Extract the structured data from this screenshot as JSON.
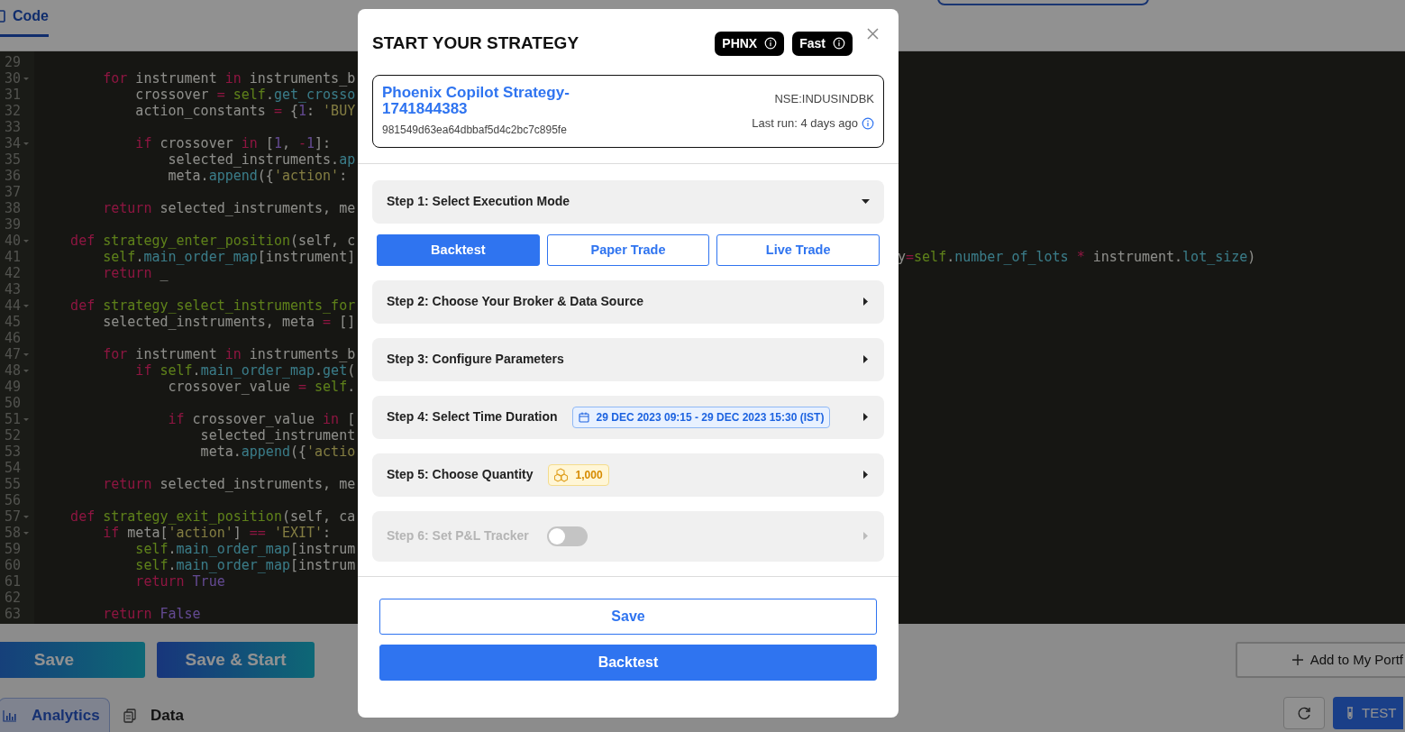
{
  "code_tab": {
    "label": "Code",
    "selected": true
  },
  "editor": {
    "lines": [
      {
        "num": "29",
        "foldable": false
      },
      {
        "num": "30",
        "foldable": true,
        "parts": [
          {
            "kind": "keyword",
            "text": "        for"
          },
          {
            "kind": "plain",
            "text": " instrument "
          },
          {
            "kind": "keyword",
            "text": "in"
          },
          {
            "kind": "plain",
            "text": " instruments_b"
          }
        ]
      },
      {
        "num": "31",
        "foldable": false,
        "parts": [
          {
            "kind": "plain",
            "text": "            crossover "
          },
          {
            "kind": "operator",
            "text": "= "
          },
          {
            "kind": "name",
            "text": "self"
          },
          {
            "kind": "plain",
            "text": "."
          },
          {
            "kind": "attr",
            "text": "get_crosso"
          }
        ]
      },
      {
        "num": "32",
        "foldable": false,
        "parts": [
          {
            "kind": "plain",
            "text": "            action_constants "
          },
          {
            "kind": "operator",
            "text": "="
          },
          {
            "kind": "plain",
            "text": " {"
          },
          {
            "kind": "number",
            "text": "1"
          },
          {
            "kind": "plain",
            "text": ": "
          },
          {
            "kind": "string",
            "text": "'BUY"
          }
        ]
      },
      {
        "num": "33",
        "foldable": false
      },
      {
        "num": "34",
        "foldable": true,
        "parts": [
          {
            "kind": "keyword",
            "text": "            if"
          },
          {
            "kind": "plain",
            "text": " crossover "
          },
          {
            "kind": "keyword",
            "text": "in"
          },
          {
            "kind": "plain",
            "text": " ["
          },
          {
            "kind": "number",
            "text": "1"
          },
          {
            "kind": "plain",
            "text": ", "
          },
          {
            "kind": "operator",
            "text": "-"
          },
          {
            "kind": "number",
            "text": "1"
          },
          {
            "kind": "plain",
            "text": "]:"
          }
        ]
      },
      {
        "num": "35",
        "foldable": false,
        "parts": [
          {
            "kind": "plain",
            "text": "                selected_instruments."
          },
          {
            "kind": "attr",
            "text": "ap"
          }
        ]
      },
      {
        "num": "36",
        "foldable": false,
        "parts": [
          {
            "kind": "plain",
            "text": "                meta."
          },
          {
            "kind": "attr",
            "text": "append"
          },
          {
            "kind": "plain",
            "text": "({"
          },
          {
            "kind": "string",
            "text": "'action'"
          },
          {
            "kind": "plain",
            "text": ":"
          }
        ]
      },
      {
        "num": "37",
        "foldable": false
      },
      {
        "num": "38",
        "foldable": false,
        "parts": [
          {
            "kind": "keyword",
            "text": "        return"
          },
          {
            "kind": "plain",
            "text": " selected_instruments, me"
          }
        ]
      },
      {
        "num": "39",
        "foldable": false
      },
      {
        "num": "40",
        "foldable": true,
        "parts": [
          {
            "kind": "keyword",
            "text": "    def"
          },
          {
            "kind": "name",
            "text": " strategy_enter_position"
          },
          {
            "kind": "plain",
            "text": "(self, c"
          }
        ]
      },
      {
        "num": "41",
        "foldable": false,
        "parts": [
          {
            "kind": "name",
            "text": "        self"
          },
          {
            "kind": "plain",
            "text": "."
          },
          {
            "kind": "attr",
            "text": "main_order_map"
          },
          {
            "kind": "plain",
            "text": "[instrument]"
          }
        ],
        "tail": [
          {
            "kind": "plain",
            "text": "y"
          },
          {
            "kind": "operator",
            "text": "="
          },
          {
            "kind": "name",
            "text": "self"
          },
          {
            "kind": "plain",
            "text": "."
          },
          {
            "kind": "attr",
            "text": "number_of_lots"
          },
          {
            "kind": "operator",
            "text": " * "
          },
          {
            "kind": "plain",
            "text": "instrument."
          },
          {
            "kind": "attr",
            "text": "lot_size"
          },
          {
            "kind": "plain",
            "text": ")"
          }
        ]
      },
      {
        "num": "42",
        "foldable": false,
        "parts": [
          {
            "kind": "keyword",
            "text": "        return"
          },
          {
            "kind": "plain",
            "text": " _"
          }
        ]
      },
      {
        "num": "43",
        "foldable": false
      },
      {
        "num": "44",
        "foldable": true,
        "parts": [
          {
            "kind": "keyword",
            "text": "    def"
          },
          {
            "kind": "name",
            "text": " strategy_select_instruments_for"
          }
        ]
      },
      {
        "num": "45",
        "foldable": false,
        "parts": [
          {
            "kind": "plain",
            "text": "        selected_instruments, meta "
          },
          {
            "kind": "operator",
            "text": "="
          },
          {
            "kind": "plain",
            "text": " []"
          }
        ]
      },
      {
        "num": "46",
        "foldable": false
      },
      {
        "num": "47",
        "foldable": true,
        "parts": [
          {
            "kind": "keyword",
            "text": "        for"
          },
          {
            "kind": "plain",
            "text": " instrument "
          },
          {
            "kind": "keyword",
            "text": "in"
          },
          {
            "kind": "plain",
            "text": " instruments_b"
          }
        ]
      },
      {
        "num": "48",
        "foldable": true,
        "parts": [
          {
            "kind": "keyword",
            "text": "            if"
          },
          {
            "kind": "name",
            "text": " self"
          },
          {
            "kind": "plain",
            "text": "."
          },
          {
            "kind": "attr",
            "text": "main_order_map"
          },
          {
            "kind": "plain",
            "text": "."
          },
          {
            "kind": "attr",
            "text": "get"
          },
          {
            "kind": "plain",
            "text": "("
          }
        ]
      },
      {
        "num": "49",
        "foldable": false,
        "parts": [
          {
            "kind": "plain",
            "text": "                crossover_value "
          },
          {
            "kind": "operator",
            "text": "= "
          },
          {
            "kind": "name",
            "text": "self"
          },
          {
            "kind": "plain",
            "text": "."
          }
        ]
      },
      {
        "num": "50",
        "foldable": false
      },
      {
        "num": "51",
        "foldable": true,
        "parts": [
          {
            "kind": "keyword",
            "text": "                if"
          },
          {
            "kind": "plain",
            "text": " crossover_value "
          },
          {
            "kind": "keyword",
            "text": "in"
          },
          {
            "kind": "plain",
            "text": " ["
          }
        ]
      },
      {
        "num": "52",
        "foldable": false,
        "parts": [
          {
            "kind": "plain",
            "text": "                    selected_instrument"
          }
        ]
      },
      {
        "num": "53",
        "foldable": false,
        "parts": [
          {
            "kind": "plain",
            "text": "                    meta."
          },
          {
            "kind": "attr",
            "text": "append"
          },
          {
            "kind": "plain",
            "text": "({"
          },
          {
            "kind": "string",
            "text": "'actio"
          }
        ]
      },
      {
        "num": "54",
        "foldable": false
      },
      {
        "num": "55",
        "foldable": false,
        "parts": [
          {
            "kind": "keyword",
            "text": "        return"
          },
          {
            "kind": "plain",
            "text": " selected_instruments, me"
          }
        ]
      },
      {
        "num": "56",
        "foldable": false
      },
      {
        "num": "57",
        "foldable": true,
        "parts": [
          {
            "kind": "keyword",
            "text": "    def"
          },
          {
            "kind": "name",
            "text": " strategy_exit_position"
          },
          {
            "kind": "plain",
            "text": "(self, ca"
          }
        ]
      },
      {
        "num": "58",
        "foldable": true,
        "parts": [
          {
            "kind": "keyword",
            "text": "        if"
          },
          {
            "kind": "plain",
            "text": " meta["
          },
          {
            "kind": "string",
            "text": "'action'"
          },
          {
            "kind": "plain",
            "text": "] "
          },
          {
            "kind": "operator",
            "text": "== "
          },
          {
            "kind": "string",
            "text": "'EXIT'"
          },
          {
            "kind": "plain",
            "text": ":"
          }
        ]
      },
      {
        "num": "59",
        "foldable": false,
        "parts": [
          {
            "kind": "name",
            "text": "            self"
          },
          {
            "kind": "plain",
            "text": "."
          },
          {
            "kind": "attr",
            "text": "main_order_map"
          },
          {
            "kind": "plain",
            "text": "[instrum"
          }
        ]
      },
      {
        "num": "60",
        "foldable": false,
        "parts": [
          {
            "kind": "name",
            "text": "            self"
          },
          {
            "kind": "plain",
            "text": "."
          },
          {
            "kind": "attr",
            "text": "main_order_map"
          },
          {
            "kind": "plain",
            "text": "[instrum"
          }
        ]
      },
      {
        "num": "61",
        "foldable": false,
        "parts": [
          {
            "kind": "keyword",
            "text": "            return"
          },
          {
            "kind": "number",
            "text": " True"
          }
        ]
      },
      {
        "num": "62",
        "foldable": false
      },
      {
        "num": "63",
        "foldable": false,
        "parts": [
          {
            "kind": "keyword",
            "text": "        return"
          },
          {
            "kind": "number",
            "text": " False"
          }
        ]
      }
    ]
  },
  "actions": {
    "save": "Save",
    "save_start": "Save & Start",
    "add_portfolio": "Add to My Portf"
  },
  "bottom_tabs": [
    {
      "label": "Analytics",
      "selected": true,
      "kind": "chart"
    },
    {
      "label": "Data",
      "selected": false,
      "kind": "doc"
    }
  ],
  "test_button": "TEST",
  "modal": {
    "title": "START YOUR STRATEGY",
    "badges": [
      "PHNX",
      "Fast"
    ],
    "strategy": {
      "name": "Phoenix Copilot Strategy-1741844383",
      "id": "981549d63ea64dbbaf5d4c2bc7c895fe",
      "symbol": "NSE:INDUSINDBK",
      "last_run": "Last run: 4 days ago"
    },
    "steps": [
      {
        "label": "Step 1: Select Execution Mode",
        "expanded": true,
        "disabled": false,
        "options": [
          {
            "label": "Backtest",
            "selected": true
          },
          {
            "label": "Paper Trade",
            "selected": false
          },
          {
            "label": "Live Trade",
            "selected": false
          }
        ]
      },
      {
        "label": "Step 2: Choose Your Broker & Data Source",
        "expanded": false,
        "disabled": false
      },
      {
        "label": "Step 3: Configure Parameters",
        "expanded": false,
        "disabled": false
      },
      {
        "label": "Step 4: Select Time Duration",
        "expanded": false,
        "disabled": false,
        "chip": {
          "kind": "date",
          "text": "29 DEC 2023 09:15 - 29 DEC 2023 15:30 (IST)"
        }
      },
      {
        "label": "Step 5: Choose Quantity",
        "expanded": false,
        "disabled": false,
        "chip": {
          "kind": "quantity",
          "text": "1,000"
        }
      },
      {
        "label": "Step 6: Set P&L Tracker",
        "expanded": false,
        "disabled": true,
        "toggle": {
          "on": false
        }
      }
    ],
    "buttons": [
      {
        "label": "Save",
        "kind": "outline"
      },
      {
        "label": "Backtest",
        "kind": "primary"
      }
    ]
  }
}
